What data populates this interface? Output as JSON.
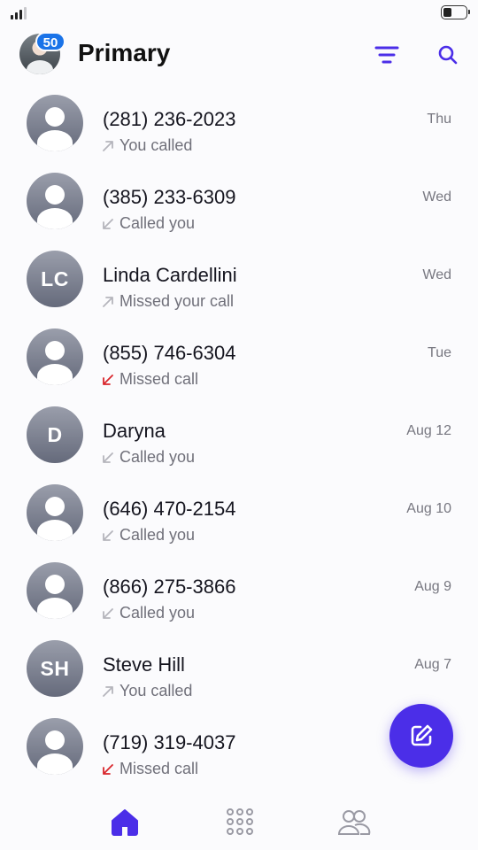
{
  "header": {
    "title": "Primary",
    "badge_count": "50"
  },
  "calls": [
    {
      "name": "(281) 236-2023",
      "status": "You called",
      "direction": "outgoing",
      "date": "Thu",
      "avatar": "person",
      "initials": ""
    },
    {
      "name": "(385) 233-6309",
      "status": "Called you",
      "direction": "incoming",
      "date": "Wed",
      "avatar": "person",
      "initials": ""
    },
    {
      "name": "Linda Cardellini",
      "status": "Missed your call",
      "direction": "outgoing",
      "date": "Wed",
      "avatar": "initials",
      "initials": "LC"
    },
    {
      "name": "(855) 746-6304",
      "status": "Missed call",
      "direction": "missed",
      "date": "Tue",
      "avatar": "person",
      "initials": ""
    },
    {
      "name": "Daryna",
      "status": "Called you",
      "direction": "incoming",
      "date": "Aug 12",
      "avatar": "initials",
      "initials": "D"
    },
    {
      "name": "(646) 470-2154",
      "status": "Called you",
      "direction": "incoming",
      "date": "Aug 10",
      "avatar": "person",
      "initials": ""
    },
    {
      "name": "(866) 275-3866",
      "status": "Called you",
      "direction": "incoming",
      "date": "Aug 9",
      "avatar": "person",
      "initials": ""
    },
    {
      "name": "Steve Hill",
      "status": "You called",
      "direction": "outgoing",
      "date": "Aug 7",
      "avatar": "initials",
      "initials": "SH"
    },
    {
      "name": "(719) 319-4037",
      "status": "Missed call",
      "direction": "missed",
      "date": "",
      "avatar": "person",
      "initials": ""
    }
  ],
  "icons": {
    "filter": "filter-icon",
    "search": "search-icon",
    "compose": "compose-icon",
    "home": "home-icon",
    "keypad": "keypad-icon",
    "contacts": "contacts-icon"
  },
  "colors": {
    "accent": "#4b2ee8",
    "badge": "#1a73e8",
    "missed": "#d9262c",
    "arrow": "#b5b5bc"
  }
}
